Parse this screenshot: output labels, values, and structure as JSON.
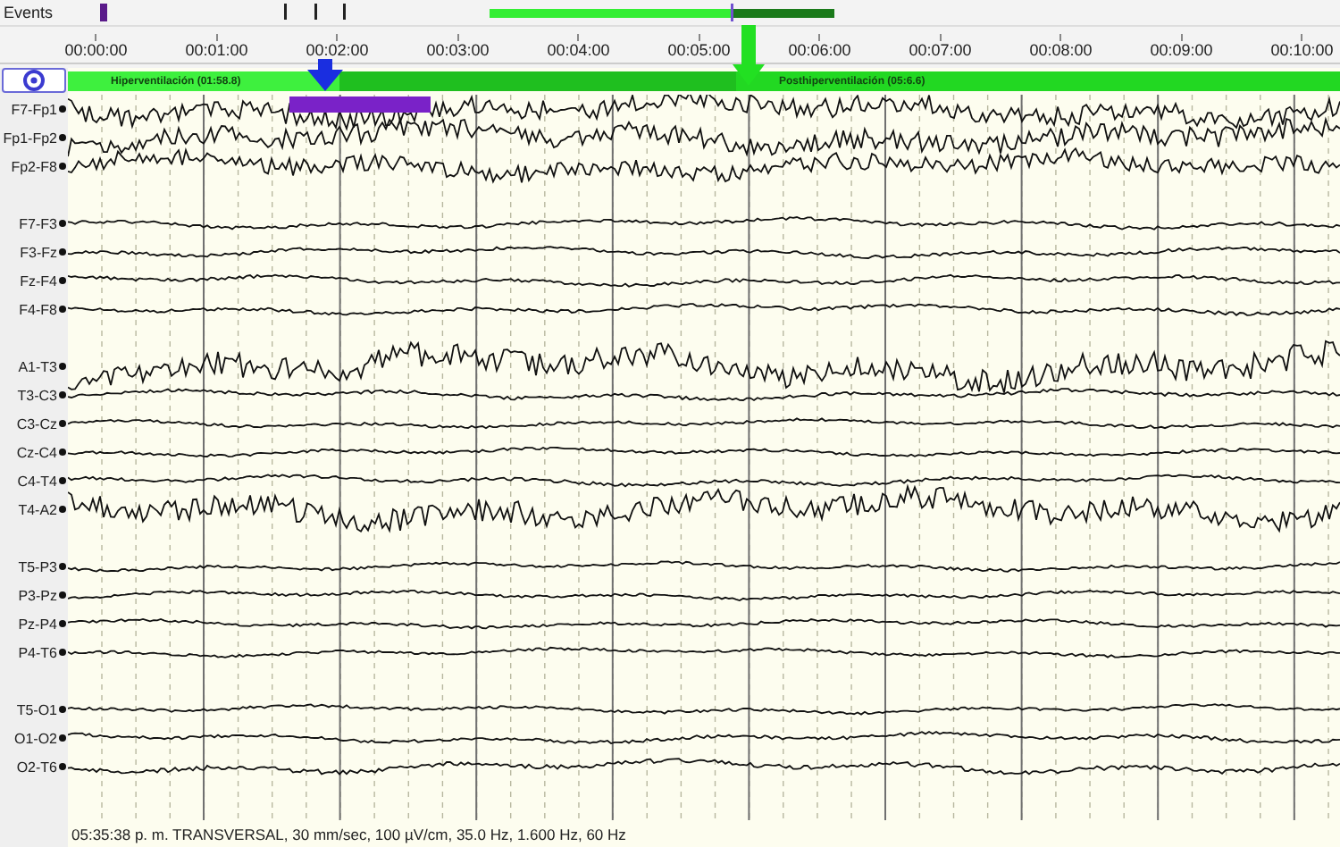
{
  "events": {
    "label": "Events"
  },
  "ruler": {
    "labels": [
      "00:00:00",
      "00:01:00",
      "00:02:00",
      "00:03:00",
      "00:04:00",
      "00:05:00",
      "00:06:00",
      "00:07:00",
      "00:08:00",
      "00:09:00",
      "00:10:00"
    ]
  },
  "annotations": [
    {
      "label": "Hiperventilación (01:58.8)",
      "color": "#3ef03e"
    },
    {
      "color": "#1fbf1f"
    },
    {
      "label": "Posthiperventilación (05:6.6)",
      "color": "#22d822"
    }
  ],
  "montage": {
    "groups": [
      {
        "channels": [
          "F7-Fp1",
          "Fp1-Fp2",
          "Fp2-F8"
        ]
      },
      {
        "channels": [
          "F7-F3",
          "F3-Fz",
          "Fz-F4",
          "F4-F8"
        ]
      },
      {
        "channels": [
          "A1-T3",
          "T3-C3",
          "C3-Cz",
          "Cz-C4",
          "C4-T4",
          "T4-A2"
        ]
      },
      {
        "channels": [
          "T5-P3",
          "P3-Pz",
          "Pz-P4",
          "P4-T6"
        ]
      },
      {
        "channels": [
          "T5-O1",
          "O1-O2",
          "O2-T6"
        ]
      }
    ]
  },
  "status_bar": "05:35:38 p. m. TRANSVERSAL, 30 mm/sec, 100 µV/cm, 35.0 Hz, 1.600 Hz, 60 Hz"
}
